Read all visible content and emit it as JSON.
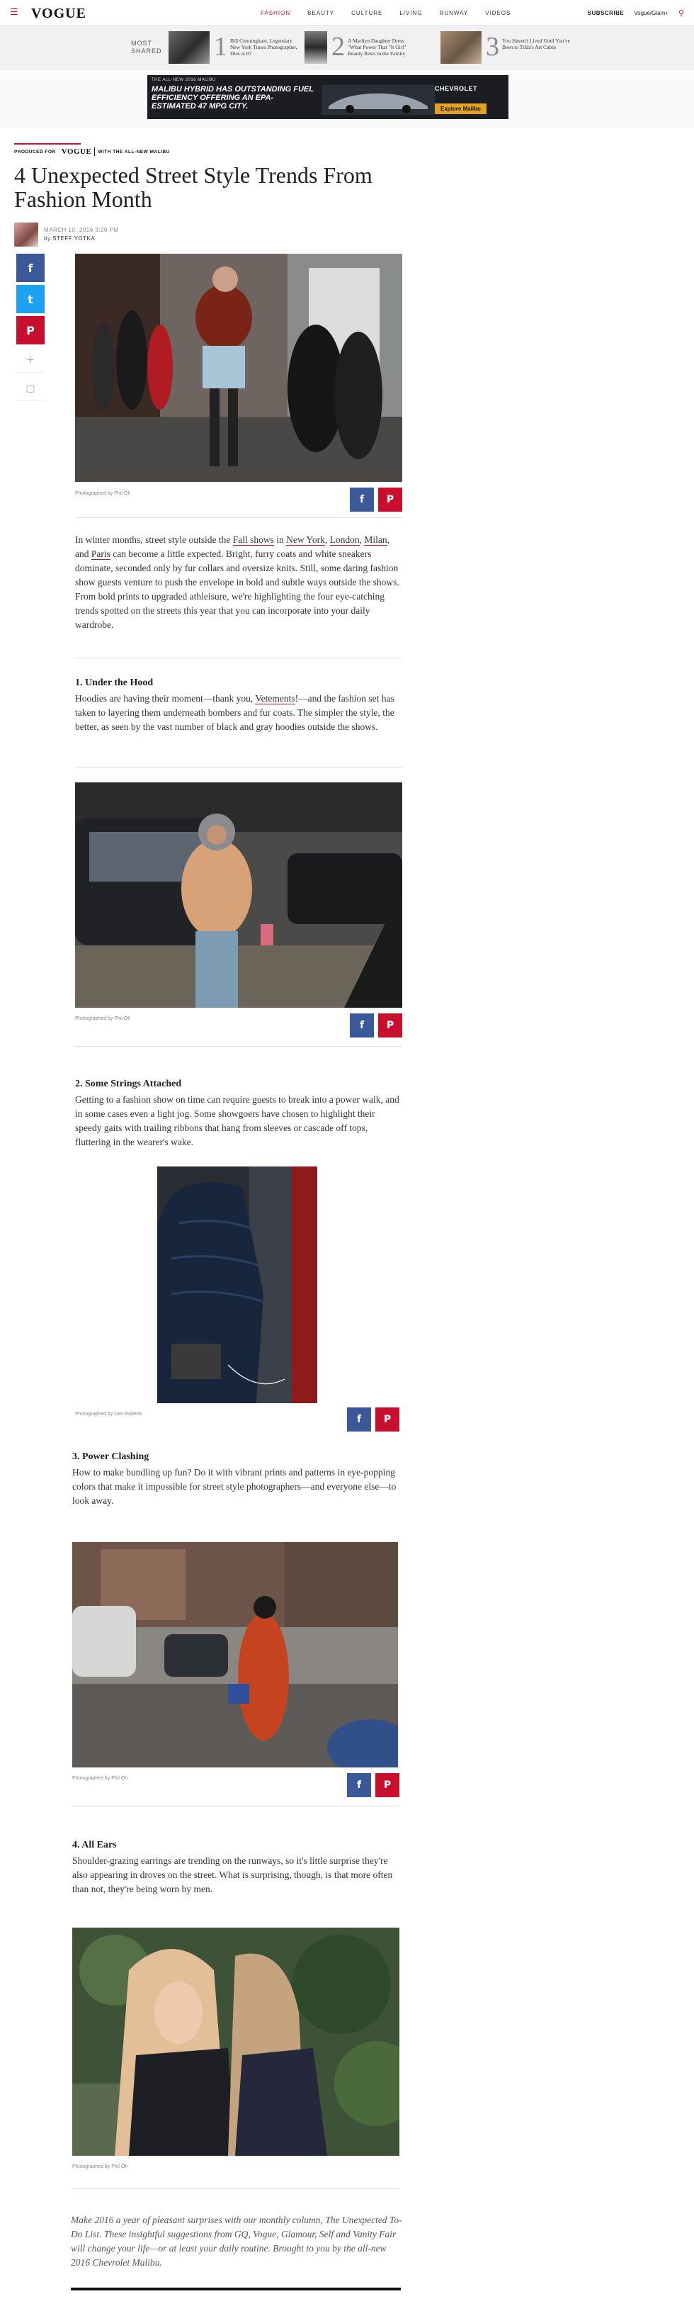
{
  "header": {
    "logo": "VOGUE",
    "nav": [
      "FASHION",
      "BEAUTY",
      "CULTURE",
      "LIVING",
      "RUNWAY",
      "VIDEOS"
    ],
    "active_nav": "FASHION",
    "subscribe": "SUBSCRIBE",
    "promo": "Vogue/Glam+",
    "menu_icon": "hamburger-icon",
    "search_icon": "search-icon"
  },
  "most_shared": {
    "label_1": "MOST",
    "label_2": "SHARED",
    "items": [
      {
        "num": "1",
        "text": "Bill Cunningham, Legendary New York Times Photographer, Dies at 87"
      },
      {
        "num": "2",
        "text": "A Marilyn Daughter Dress \"What Power That \"It Girl\" Beauty Rests in the Family"
      },
      {
        "num": "3",
        "text": "You Haven't Lived Until You've Been to Tilda's Art Cabin"
      }
    ]
  },
  "ad": {
    "tag": "THE ALL-NEW 2016 MALIBU",
    "headline": "MALIBU HYBRID HAS OUTSTANDING FUEL EFFICIENCY OFFERING AN EPA-ESTIMATED 47 MPG CITY.",
    "cta": "Explore Malibu",
    "brand": "CHEVROLET"
  },
  "article": {
    "sponsor_prefix": "PRODUCED FOR",
    "sponsor_logo": "VOGUE",
    "sponsor_suffix": "WITH THE ALL-NEW MALIBU",
    "title": "4 Unexpected Street Style Trends From Fashion Month",
    "date": "MARCH 10, 2016 3:20 PM",
    "byline_prefix": "by",
    "author": "STEFF YOTKA",
    "photo_credit_1": "Photographed by Phil Oh",
    "intro_p1": "In winter months, street style outside the ",
    "intro_link1": "Fall shows",
    "intro_p2": " in ",
    "intro_link2": "New York",
    "intro_p3": ", ",
    "intro_link3": "London",
    "intro_p4": ", ",
    "intro_link4": "Milan",
    "intro_p5": ", and ",
    "intro_link5": "Paris",
    "intro_p6": " can become a little expected. Bright, furry coats and white sneakers dominate, seconded only by fur collars and oversize knits. Still, some daring fashion show guests venture to push the envelope in bold and subtle ways outside the shows. From bold prints to upgraded athleisure, we're highlighting the four eye-catching trends spotted on the streets this year that you can incorporate into your daily wardrobe.",
    "h1": "1. Under the Hood",
    "s1_a": "Hoodies are having their moment—thank you, ",
    "s1_link": "Vetements",
    "s1_b": "!—and the fashion set has taken to layering them underneath bombers and fur coats. The simpler the style, the better, as seen by the vast number of black and gray hoodies outside the shows.",
    "photo_credit_2": "Photographed by Phil Oh",
    "h2": "2. Some Strings Attached",
    "s2": "Getting to a fashion show on time can require guests to break into a power walk, and in some cases even a light jog. Some showgoers have chosen to highlight their speedy gaits with trailing ribbons that hang from sleeves or cascade off tops, fluttering in the wearer's wake.",
    "photo_credit_3": "Photographed by Dan Roberts",
    "h3": "3. Power Clashing",
    "s3": "How to make bundling up fun? Do it with vibrant prints and patterns in eye-popping colors that make it impossible for street style photographers—and everyone else—to look away.",
    "photo_credit_4": "Photographed by Phil Oh",
    "h4": "4. All Ears",
    "s4": "Shoulder-grazing earrings are trending on the runways, so it's little surprise they're also appearing in droves on the street. What is surprising, though, is that more often than not, they're being worn by men.",
    "photo_credit_5": "Photographed by Phil Oh",
    "outro": "Make 2016 a year of pleasant surprises with our monthly column, The Unexpected To-Do List. These insightful suggestions from GQ, Vogue, Glamour, Self and Vanity Fair will change your life—or at least your daily routine. Brought to you by the all-new 2016 Chevrolet Malibu."
  },
  "share": {
    "facebook_glyph": "f",
    "twitter_glyph": "t",
    "pinterest_glyph": "P",
    "plus_glyph": "+",
    "comment_glyph": "▢"
  },
  "colors": {
    "accent": "#c8102e",
    "facebook": "#3b5998",
    "twitter": "#1da1f2"
  }
}
